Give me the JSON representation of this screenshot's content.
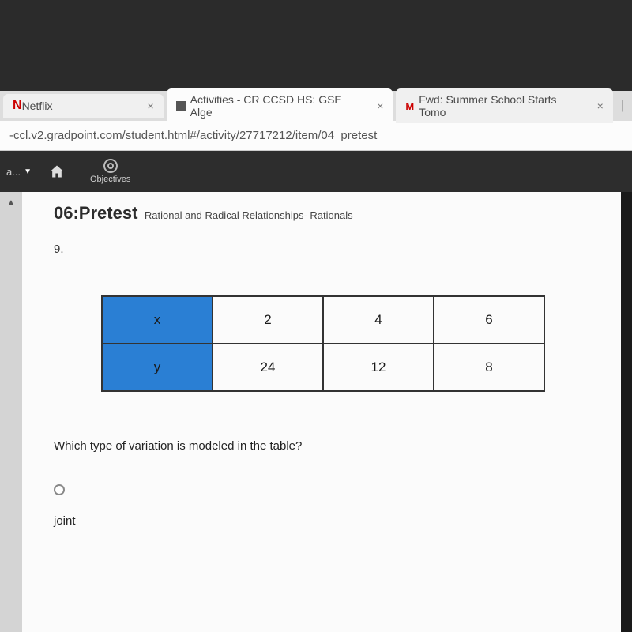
{
  "tabs": {
    "t0": {
      "label": "Netflix"
    },
    "t1": {
      "label": "Activities - CR CCSD HS: GSE Alge"
    },
    "t2": {
      "label": "Fwd: Summer School Starts Tomo"
    }
  },
  "url": "-ccl.v2.gradpoint.com/student.html#/activity/27717212/item/04_pretest",
  "toolbar": {
    "side_label": "a...",
    "objectives": "Objectives"
  },
  "page": {
    "title_main": "06:Pretest",
    "title_sub": "Rational and Radical Relationships- Rationals",
    "q_num": "9.",
    "table": {
      "row1": {
        "hdr": "x",
        "c1": "2",
        "c2": "4",
        "c3": "6"
      },
      "row2": {
        "hdr": "y",
        "c1": "24",
        "c2": "12",
        "c3": "8"
      }
    },
    "question": "Which type of variation is modeled in the table?",
    "option1": "joint"
  }
}
